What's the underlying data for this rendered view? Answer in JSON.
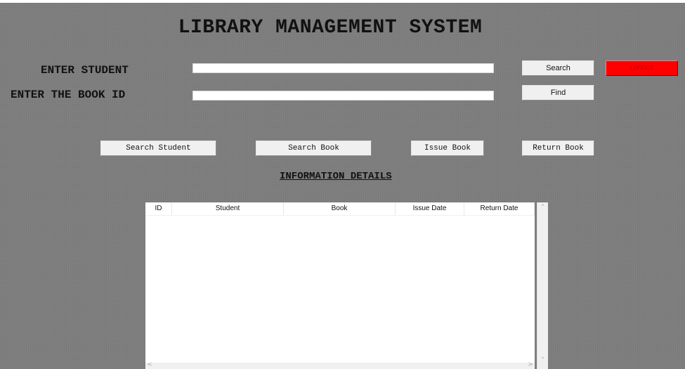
{
  "window": {
    "title": "LIBRARY MANAGEMENT SYSTEM"
  },
  "form": {
    "student_label": "ENTER STUDENT",
    "student_value": "",
    "book_label": "ENTER THE BOOK ID",
    "book_value": ""
  },
  "buttons": {
    "search": "Search",
    "find": "Find",
    "logout": "LOGOUT",
    "search_student": "Search Student",
    "search_book": "Search Book",
    "issue_book": "Issue Book",
    "return_book": "Return Book"
  },
  "info": {
    "heading": "INFORMATION DETAILS",
    "columns": [
      "ID",
      "Student",
      "Book",
      "Issue Date",
      "Return Date"
    ],
    "rows": []
  },
  "colors": {
    "background": "#7f7f7f",
    "logout": "#ff0000"
  },
  "icons": {
    "scroll_up": "chevron-up-icon",
    "scroll_down": "chevron-down-icon",
    "scroll_left": "chevron-left-icon",
    "scroll_right": "chevron-right-icon"
  }
}
